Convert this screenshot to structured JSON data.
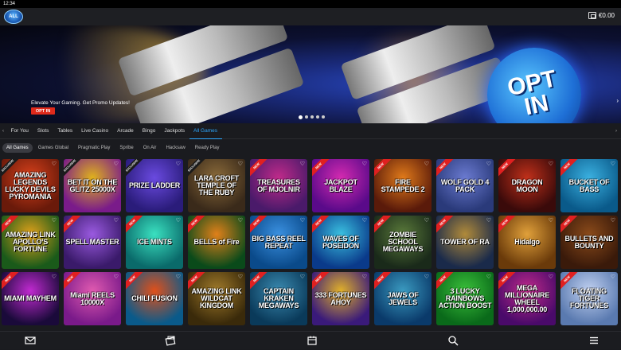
{
  "status": {
    "time": "12:34"
  },
  "header": {
    "logo_text": "ALL",
    "balance": "€0.00"
  },
  "hero": {
    "headline": "Elevate Your Gaming. Get Promo Updates!",
    "cta_label": "OPT IN",
    "sign_line1": "OPT",
    "sign_line2": "IN",
    "slide_count": 5,
    "active_slide": 0
  },
  "nav": {
    "tabs": [
      "For You",
      "Slots",
      "Tables",
      "Live Casino",
      "Arcade",
      "Bingo",
      "Jackpots",
      "All Games"
    ],
    "active_tab": "All Games"
  },
  "filters": {
    "chips": [
      "All Games",
      "Games Global",
      "Pragmatic Play",
      "Spribe",
      "On Air",
      "Hacksaw",
      "Ready Play"
    ],
    "active_chip": "All Games"
  },
  "games": [
    [
      {
        "title": "AMAZING LEGENDS LUCKY DEVILS PYROMANIA",
        "ribbon": "EXCLUSIVE",
        "color1": "#6a1a0a",
        "color2": "#d9411b"
      },
      {
        "title": "BET IT ON THE GLITZ 25000X",
        "ribbon": "EXCLUSIVE",
        "color1": "#7a1b8a",
        "color2": "#e0b21c"
      },
      {
        "title": "PRIZE LADDER",
        "ribbon": "EXCLUSIVE",
        "color1": "#2a1c7a",
        "color2": "#6a4ae0"
      },
      {
        "title": "LARA CROFT TEMPLE OF THE RUBY",
        "ribbon": "EXCLUSIVE",
        "color1": "#3a2a1a",
        "color2": "#8a6a3a"
      },
      {
        "title": "TREASURES OF MJOLNIR",
        "ribbon": "NEW",
        "color1": "#4a1a6a",
        "color2": "#c02a8a"
      },
      {
        "title": "JACKPOT BLAZE",
        "ribbon": "NEW",
        "color1": "#5a0a8a",
        "color2": "#d42ab0"
      },
      {
        "title": "FIRE STAMPEDE 2",
        "ribbon": "NEW",
        "color1": "#5a1a0a",
        "color2": "#e07a1a"
      },
      {
        "title": "WOLF GOLD 4 PACK",
        "ribbon": "NEW",
        "color1": "#2a3a7a",
        "color2": "#6a7ad0"
      },
      {
        "title": "DRAGON MOON",
        "ribbon": "NEW",
        "color1": "#3a0a0a",
        "color2": "#c0301a"
      },
      {
        "title": "BUCKET OF BASS",
        "ribbon": "NEW",
        "color1": "#0a5a8a",
        "color2": "#3ab0e0"
      }
    ],
    [
      {
        "title": "AMAZING LINK APOLLO'S FORTUNE",
        "ribbon": "NEW",
        "color1": "#1a5a1a",
        "color2": "#e0a01a"
      },
      {
        "title": "SPELL MASTER",
        "ribbon": "NEW",
        "color1": "#3a1a6a",
        "color2": "#9a5ae0"
      },
      {
        "title": "ICE MINTS",
        "ribbon": "NEW",
        "color1": "#0a6a6a",
        "color2": "#3ae0c0"
      },
      {
        "title": "BELLS of Fire",
        "ribbon": "NEW",
        "color1": "#0a4a1a",
        "color2": "#e0801a"
      },
      {
        "title": "BIG BASS REEL REPEAT",
        "ribbon": "NEW",
        "color1": "#0a4a8a",
        "color2": "#3a90e0"
      },
      {
        "title": "WAVES OF POSEIDON",
        "ribbon": "NEW",
        "color1": "#0a3a8a",
        "color2": "#3ac0e0"
      },
      {
        "title": "ZOMBIE SCHOOL MEGAWAYS",
        "ribbon": "NEW",
        "color1": "#1a2a1a",
        "color2": "#5a7a3a"
      },
      {
        "title": "TOWER OF RA",
        "ribbon": "NEW",
        "color1": "#1a2a4a",
        "color2": "#b08a3a"
      },
      {
        "title": "Hidalgo",
        "ribbon": "NEW",
        "color1": "#6a3a0a",
        "color2": "#e0a03a"
      },
      {
        "title": "BULLETS AND BOUNTY",
        "ribbon": "NEW",
        "color1": "#3a1a0a",
        "color2": "#8a4a1a"
      }
    ],
    [
      {
        "title": "MIAMI MAYHEM",
        "ribbon": "NEW",
        "color1": "#1a0a3a",
        "color2": "#c02ad0"
      },
      {
        "title": "Miami REELS 10000X",
        "ribbon": "NEW",
        "color1": "#7a1a8a",
        "color2": "#e05ab0"
      },
      {
        "title": "CHILI FUSION",
        "ribbon": "NEW",
        "color1": "#0a5a8a",
        "color2": "#e0501a"
      },
      {
        "title": "AMAZING LINK WILDCAT KINGDOM",
        "ribbon": "NEW",
        "color1": "#3a2a0a",
        "color2": "#a07a2a"
      },
      {
        "title": "CAPTAIN KRAKEN MEGAWAYS",
        "ribbon": "NEW",
        "color1": "#0a3a5a",
        "color2": "#3a8ab0"
      },
      {
        "title": "333 FORTUNES AHOY",
        "ribbon": "NEW",
        "color1": "#3a1a7a",
        "color2": "#e0b02a"
      },
      {
        "title": "JAWS OF JEWELS",
        "ribbon": "NEW",
        "color1": "#0a3a6a",
        "color2": "#3a9ac0"
      },
      {
        "title": "3 LUCKY RAINBOWS ACTION BOOST",
        "ribbon": "NEW",
        "color1": "#0a6a1a",
        "color2": "#3ac03a"
      },
      {
        "title": "MEGA MILLIONAIRE WHEEL 1,000,000.00",
        "ribbon": "NEW",
        "color1": "#4a0a6a",
        "color2": "#c02a8a"
      },
      {
        "title": "FLOATING TIGER FORTUNES",
        "ribbon": "NEW",
        "color1": "#5a7ab0",
        "color2": "#c0d0f0"
      }
    ]
  ],
  "bottom_nav": [
    {
      "name": "mail-icon"
    },
    {
      "name": "promotions-icon"
    },
    {
      "name": "calendar-icon"
    },
    {
      "name": "search-icon"
    },
    {
      "name": "menu-icon"
    }
  ]
}
